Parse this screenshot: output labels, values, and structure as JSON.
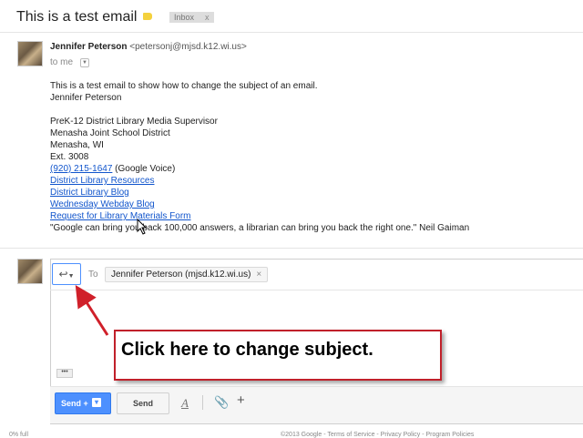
{
  "thread": {
    "subject": "This is a test email",
    "label_chip": "Inbox",
    "label_chip_close": "x"
  },
  "message": {
    "sender_name": "Jennifer Peterson",
    "sender_email": "<petersonj@mjsd.k12.wi.us>",
    "recipient_line": "to me",
    "body": {
      "line1": "This is a test email to show how to change the subject of an email.",
      "line2": "Jennifer Peterson",
      "sig1": "PreK-12 District Library Media Supervisor",
      "sig2": "Menasha Joint School District",
      "sig3": "Menasha, WI",
      "sig4": "Ext. 3008",
      "phone": "(920) 215-1647",
      "phone_suffix": " (Google Voice)",
      "link1": "District Library Resources",
      "link2": "District Library Blog",
      "link3": "Wednesday Webday Blog",
      "link4": "Request for Library Materials Form",
      "quote": "\"Google can bring you back 100,000 answers, a librarian can bring you back the right one.\" Neil Gaiman"
    }
  },
  "reply": {
    "to_label": "To",
    "recipient_chip": "Jennifer Peterson (mjsd.k12.wi.us)",
    "recipient_remove": "×",
    "more_dots": "•••",
    "send_plus_label": "Send +",
    "send_label": "Send",
    "format_glyph": "A",
    "attach_glyph": "📎",
    "insert_glyph": "+"
  },
  "annotation": {
    "callout_text": "Click here to change subject."
  },
  "footer": {
    "left": "0% full",
    "right": "©2013 Google - Terms of Service - Privacy Policy - Program Policies"
  },
  "colors": {
    "accent_blue": "#4d90fe",
    "link_blue": "#1155cc",
    "label_yellow": "#f4d13d",
    "callout_red": "#c0202a"
  }
}
